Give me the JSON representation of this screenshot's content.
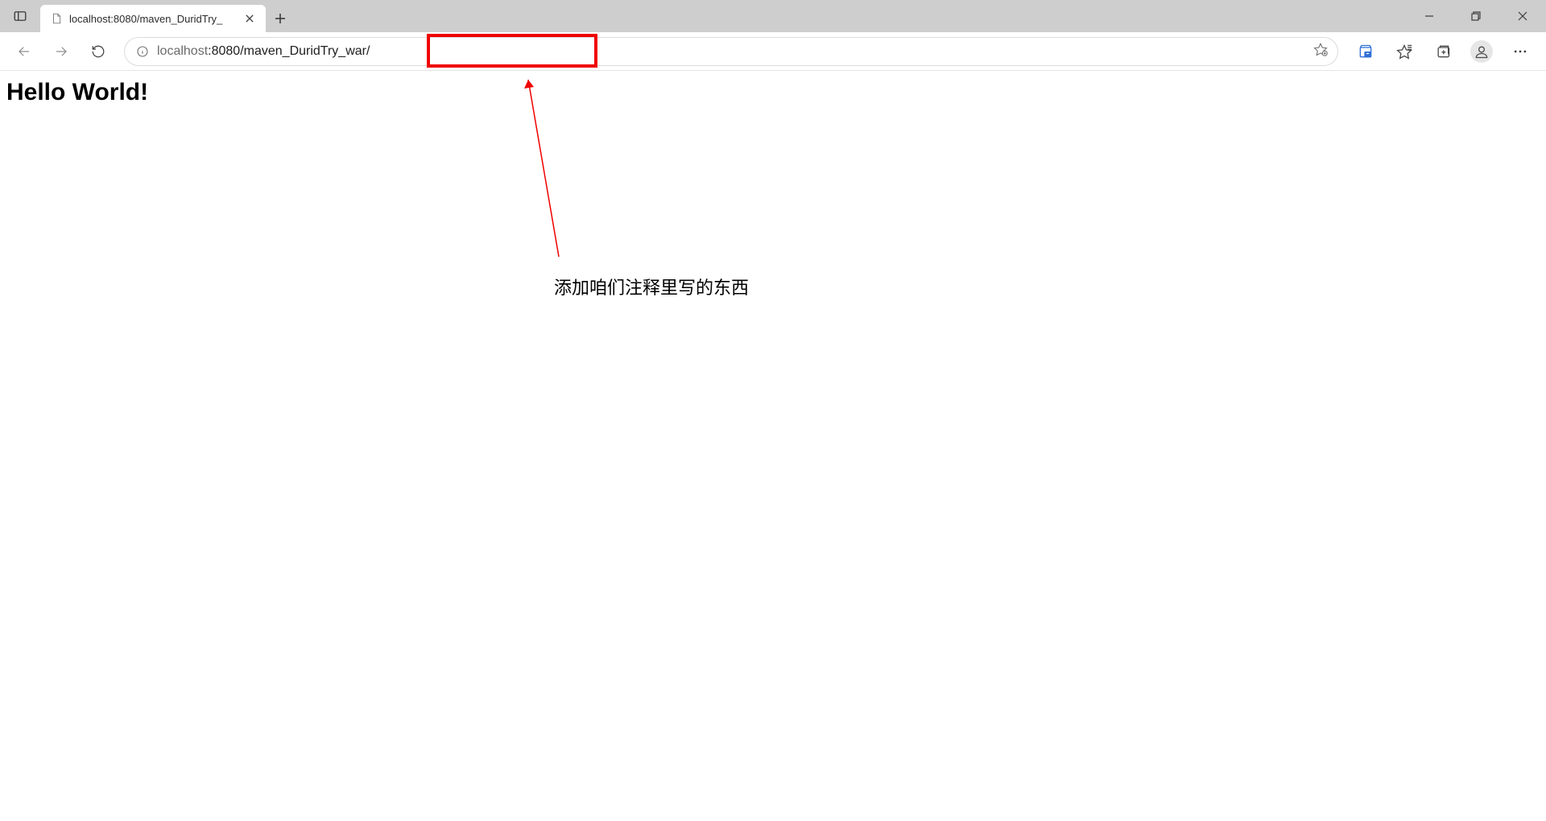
{
  "tab": {
    "title": "localhost:8080/maven_DuridTry_"
  },
  "url": {
    "host": "localhost",
    "port_path": ":8080/maven_DuridTry_war/"
  },
  "page": {
    "heading": "Hello World!"
  },
  "annotation": {
    "text": "添加咱们注释里写的东西"
  }
}
